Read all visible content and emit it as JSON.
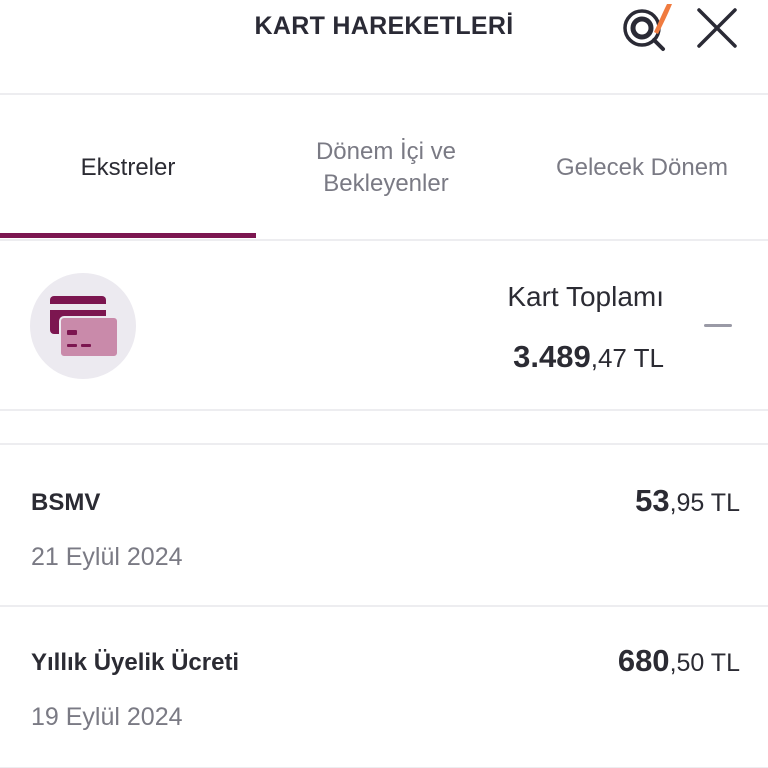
{
  "header": {
    "title": "KART HAREKETLERİ",
    "search_icon": "search-icon",
    "close_icon": "close-icon"
  },
  "tabs": [
    {
      "label": "Ekstreler",
      "active": true
    },
    {
      "label_line1": "Dönem İçi ve",
      "label_line2": "Bekleyenler",
      "active": false
    },
    {
      "label": "Gelecek Dönem",
      "active": false
    }
  ],
  "summary": {
    "icon": "credit-cards-icon",
    "label": "Kart Toplamı",
    "amount_int": "3.489",
    "amount_dec": ",47 TL"
  },
  "transactions": [
    {
      "title": "BSMV",
      "date": "21 Eylül 2024",
      "amount_int": "53",
      "amount_dec": ",95 TL"
    },
    {
      "title": "Yıllık Üyelik Ücreti",
      "date": "19 Eylül 2024",
      "amount_int": "680",
      "amount_dec": ",50 TL"
    }
  ],
  "colors": {
    "accent": "#7c1650",
    "card_light": "#c98aaa",
    "orange_mark": "#f07b3f",
    "divider": "#ededf0"
  }
}
